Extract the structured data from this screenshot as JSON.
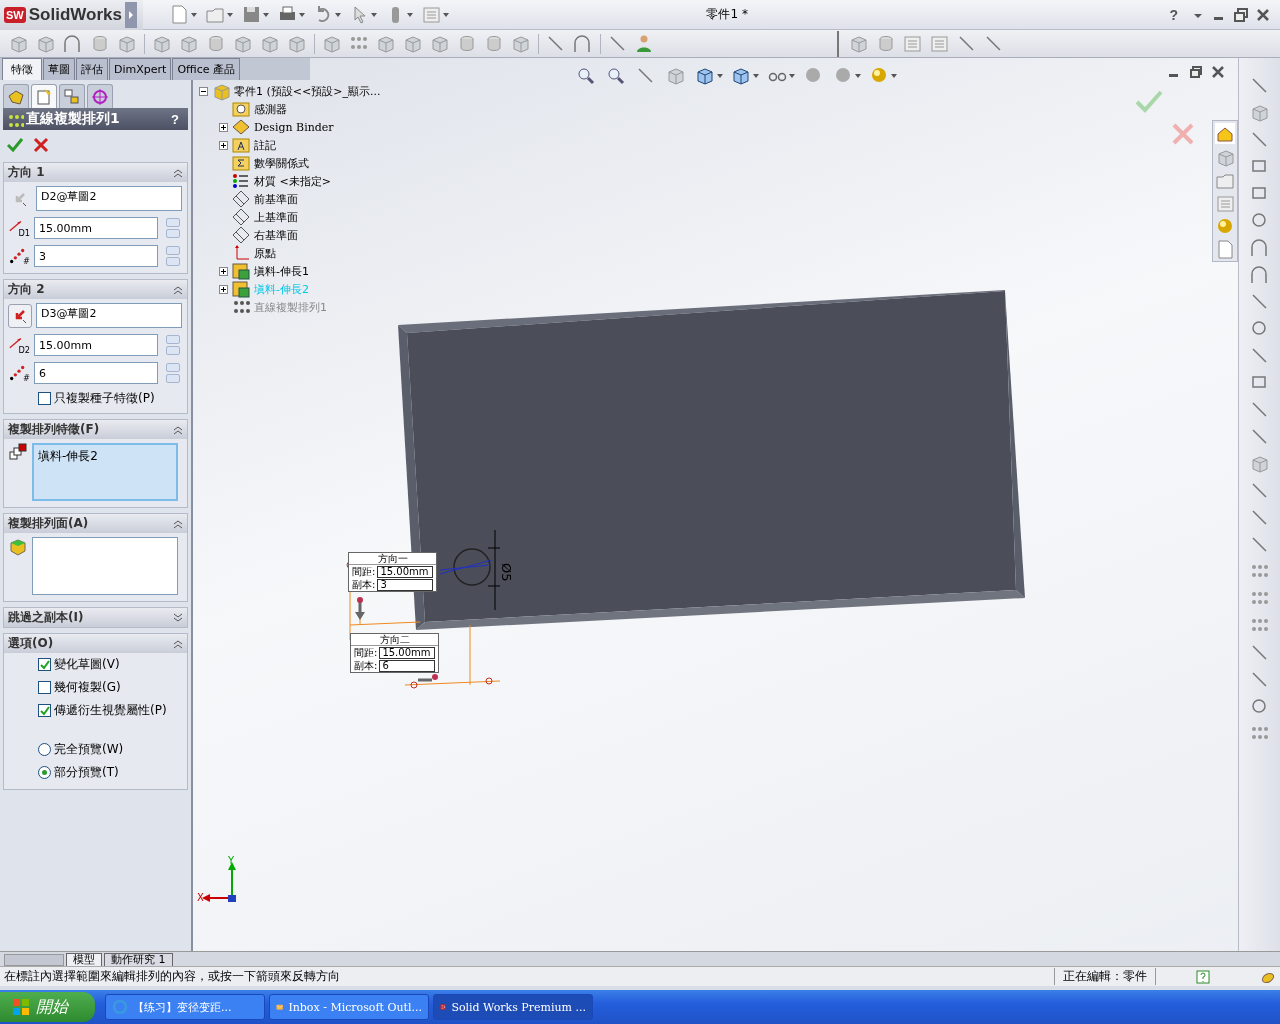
{
  "window": {
    "logo": "SW",
    "app_name": "SolidWorks",
    "title": "零件1 *",
    "help": "?"
  },
  "command_tabs": [
    {
      "label": "特徵",
      "selected": true
    },
    {
      "label": "草圖",
      "selected": false
    },
    {
      "label": "評估",
      "selected": false
    },
    {
      "label": "DimXpert",
      "selected": false
    },
    {
      "label": "Office 產品",
      "selected": false
    }
  ],
  "manager_tabs": [
    {
      "kind": "feature-tree",
      "selected": false
    },
    {
      "kind": "property",
      "selected": true
    },
    {
      "kind": "configuration",
      "selected": false
    },
    {
      "kind": "dimxpert",
      "selected": false
    }
  ],
  "property_manager": {
    "title": "直線複製排列1",
    "help": "?",
    "groups": [
      {
        "kind": "direction",
        "title": "方向 1",
        "expanded": true,
        "reverse_active": false,
        "reference": "D2@草圖2",
        "spacing_badge": "D1",
        "spacing": "15.00mm",
        "count_badge": "#",
        "count": "3"
      },
      {
        "kind": "direction",
        "title": "方向 2",
        "expanded": true,
        "reverse_active": true,
        "reference": "D3@草圖2",
        "spacing_badge": "D2",
        "spacing": "15.00mm",
        "count_badge": "#",
        "count": "6",
        "seed_only": {
          "label": "只複製種子特徵(P)",
          "checked": false
        }
      },
      {
        "kind": "feature-list",
        "title": "複製排列特徵(F)",
        "expanded": true,
        "active": true,
        "items": [
          "塡料-伸長2"
        ]
      },
      {
        "kind": "face-list",
        "title": "複製排列面(A)",
        "expanded": true,
        "active": false
      },
      {
        "kind": "collapsed",
        "title": "跳過之副本(I)",
        "expanded": false
      },
      {
        "kind": "options",
        "title": "選項(O)",
        "expanded": true,
        "checkboxes": [
          {
            "label": "變化草圖(V)",
            "checked": true
          },
          {
            "label": "幾何複製(G)",
            "checked": false
          },
          {
            "label": "傳遞衍生視覺屬性(P)",
            "checked": true
          }
        ],
        "radios": [
          {
            "label": "完全預覽(W)",
            "selected": false
          },
          {
            "label": "部分預覽(T)",
            "selected": true
          }
        ]
      }
    ]
  },
  "tree": [
    {
      "label": "零件1  (預設<<預設>_顯示...",
      "kind": "part",
      "highlighted": false,
      "grayed": false,
      "expanded": true,
      "children": [
        {
          "label": "感測器",
          "kind": "sensor-folder",
          "highlighted": false,
          "grayed": false
        },
        {
          "label": "Design Binder",
          "kind": "binder",
          "highlighted": false,
          "grayed": false,
          "expanded": false
        },
        {
          "label": "註記",
          "kind": "annotation-folder",
          "highlighted": false,
          "grayed": false,
          "expanded": false
        },
        {
          "label": "數學關係式",
          "kind": "equation-folder",
          "highlighted": false,
          "grayed": false
        },
        {
          "label": "材質 <未指定>",
          "kind": "material",
          "highlighted": false,
          "grayed": false
        },
        {
          "label": "前基準面",
          "kind": "plane",
          "highlighted": false,
          "grayed": false
        },
        {
          "label": "上基準面",
          "kind": "plane",
          "highlighted": false,
          "grayed": false
        },
        {
          "label": "右基準面",
          "kind": "plane",
          "highlighted": false,
          "grayed": false
        },
        {
          "label": "原點",
          "kind": "origin",
          "highlighted": false,
          "grayed": false
        },
        {
          "label": "塡料-伸長1",
          "kind": "extrude",
          "highlighted": false,
          "grayed": false,
          "expanded": false
        },
        {
          "label": "塡料-伸長2",
          "kind": "extrude",
          "highlighted": true,
          "grayed": false,
          "expanded": false
        },
        {
          "label": "直線複製排列1",
          "kind": "pattern",
          "highlighted": false,
          "grayed": true
        }
      ]
    }
  ],
  "canvas": {
    "callouts": [
      {
        "title": "方向一",
        "rows": [
          {
            "label": "間距:",
            "value": "15.00mm"
          },
          {
            "label": "副本:",
            "value": "3"
          }
        ]
      },
      {
        "title": "方向二",
        "rows": [
          {
            "label": "間距:",
            "value": "15.00mm"
          },
          {
            "label": "副本:",
            "value": "6"
          }
        ]
      }
    ],
    "dimension": "Ø5",
    "triad": {
      "y": "Y",
      "x": "X"
    }
  },
  "task_pane_tabs": [
    {
      "kind": "home",
      "selected": true
    },
    {
      "kind": "library",
      "selected": false
    },
    {
      "kind": "explorer",
      "selected": false
    },
    {
      "kind": "view-palette",
      "selected": false
    },
    {
      "kind": "appearance",
      "selected": false
    },
    {
      "kind": "properties",
      "selected": false
    }
  ],
  "bottom_tabs": [
    {
      "label": "模型",
      "selected": true
    },
    {
      "label": "動作研究 1",
      "selected": false
    }
  ],
  "status_bar": {
    "message": "在標註內選擇範圍來編輯排列的內容，或按一下箭頭來反轉方向",
    "editing": "正在編輯：零件"
  },
  "taskbar": {
    "start": "開始",
    "items": [
      {
        "kind": "browser",
        "label": "【练习】变径变距...",
        "selected": false
      },
      {
        "kind": "mail",
        "label": "Inbox - Microsoft Outl...",
        "selected": false
      },
      {
        "kind": "solidworks",
        "label": "Solid Works Premium ...",
        "selected": true
      }
    ]
  }
}
